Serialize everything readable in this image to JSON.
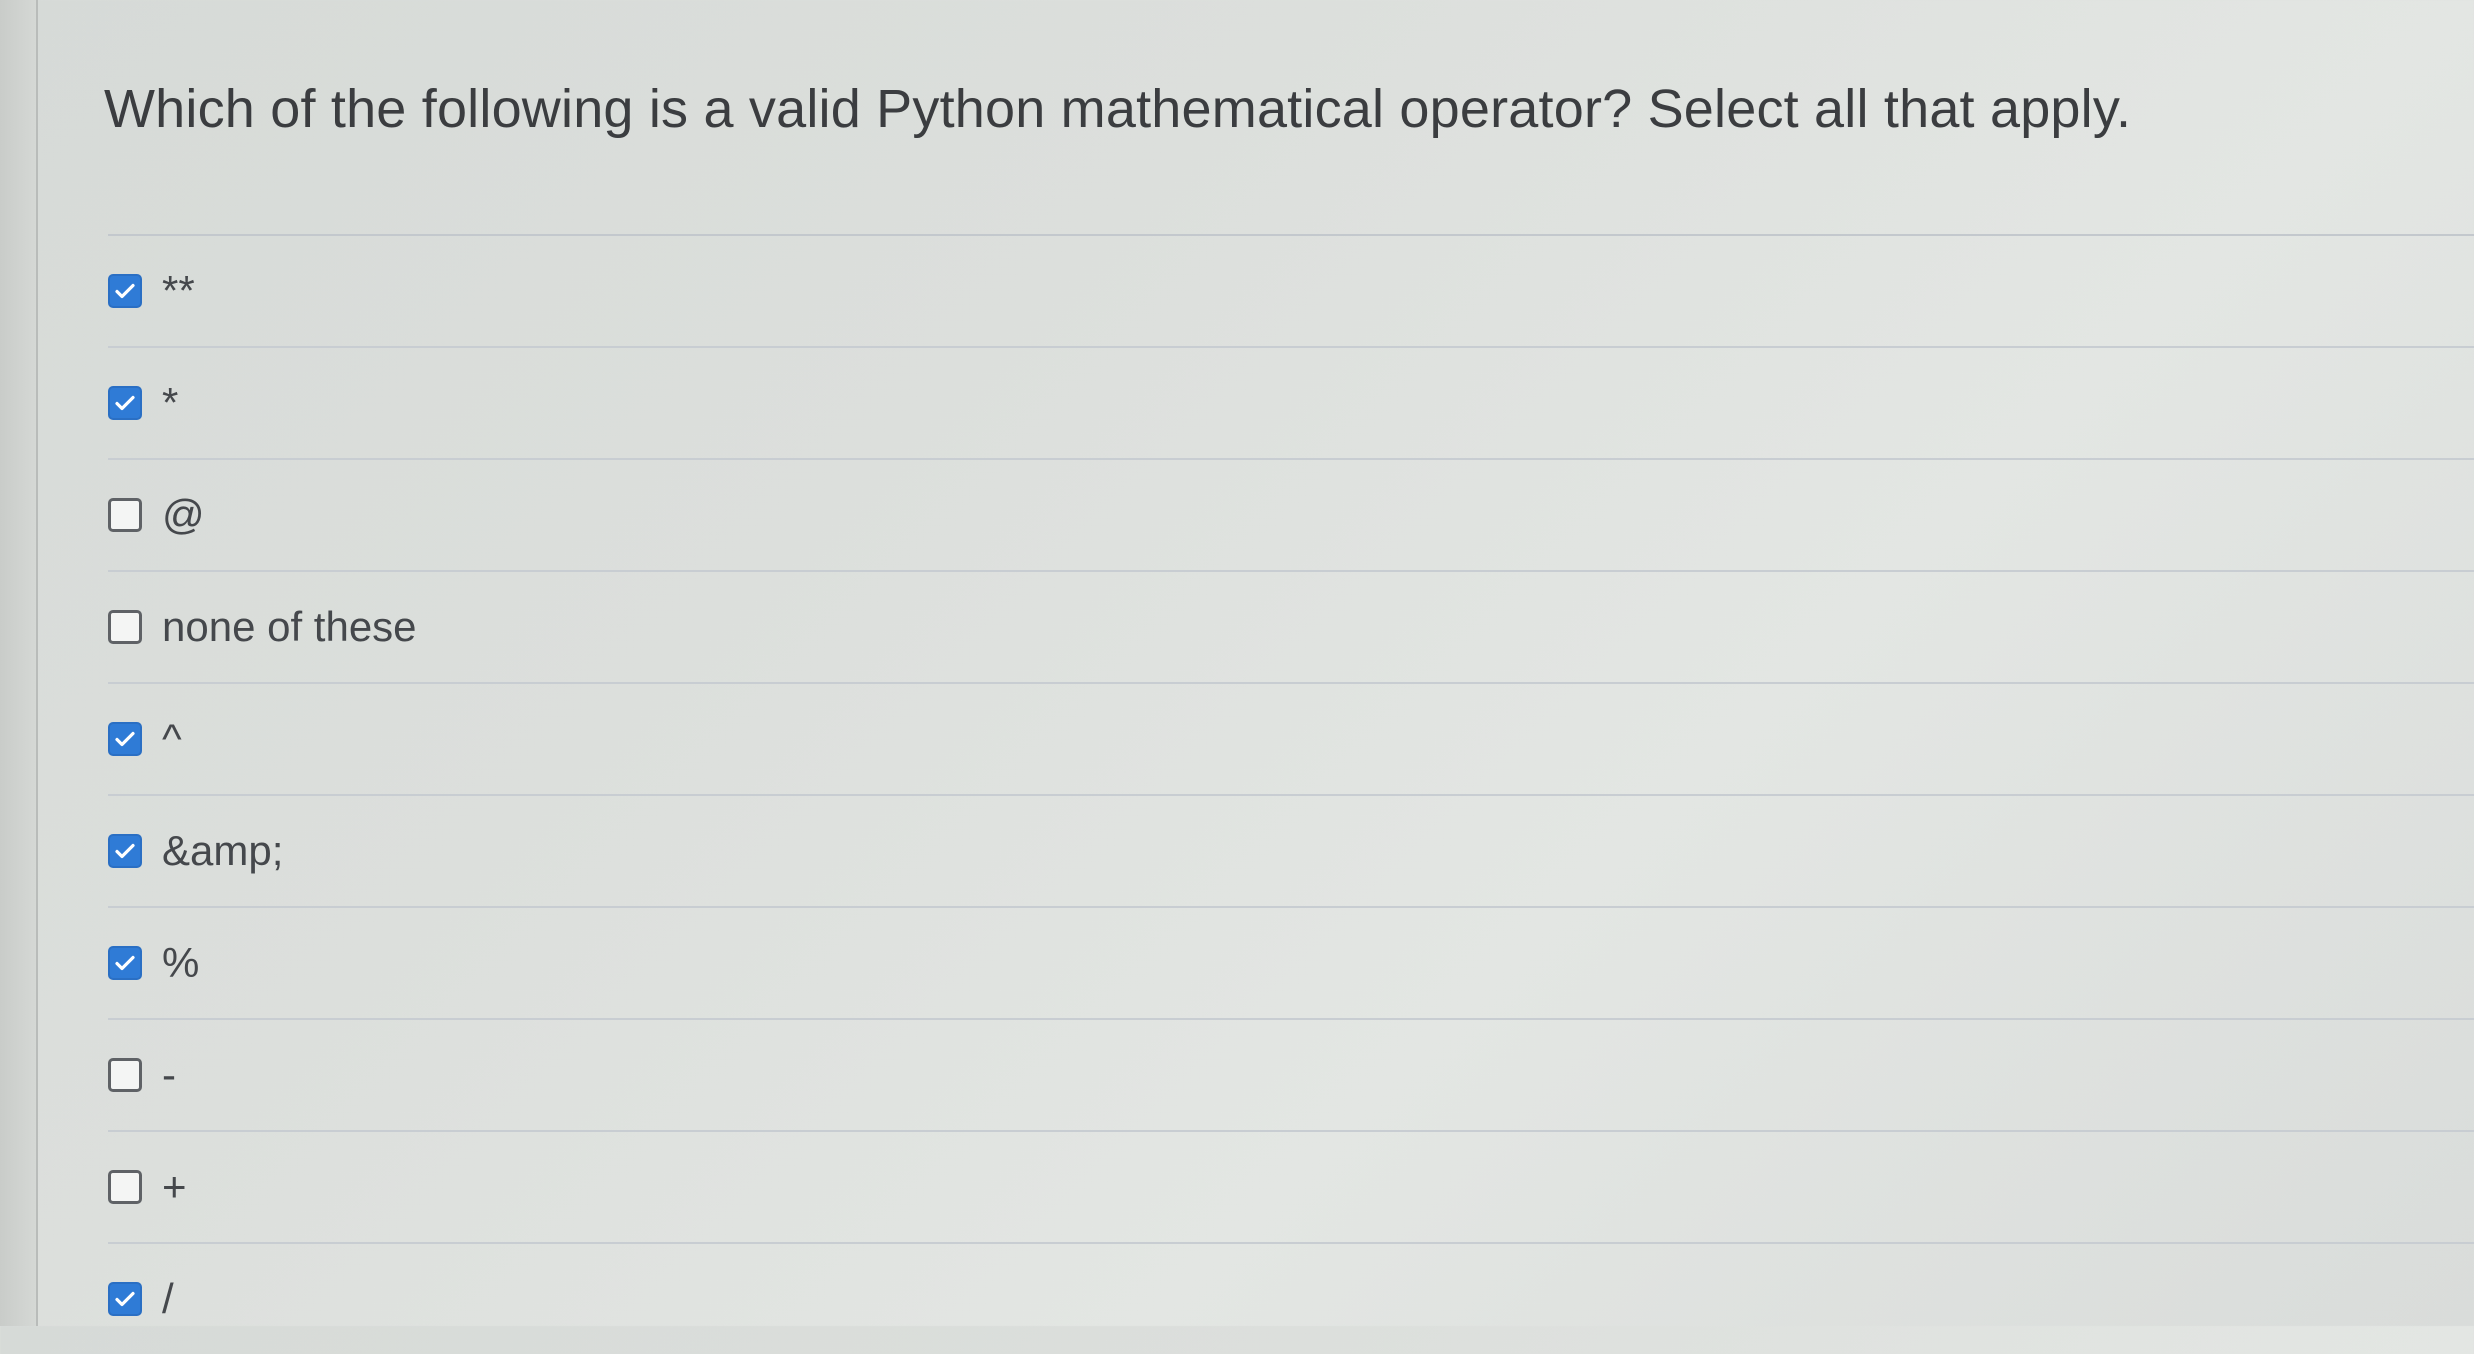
{
  "question": {
    "text": "Which of the following is a valid Python mathematical operator? Select all that apply."
  },
  "options": [
    {
      "label": "**",
      "checked": true
    },
    {
      "label": "*",
      "checked": true
    },
    {
      "label": "@",
      "checked": false
    },
    {
      "label": "none of these",
      "checked": false
    },
    {
      "label": "^",
      "checked": true
    },
    {
      "label": "&amp;",
      "checked": true
    },
    {
      "label": "%",
      "checked": true
    },
    {
      "label": "-",
      "checked": false
    },
    {
      "label": "+",
      "checked": false
    },
    {
      "label": "/",
      "checked": true
    }
  ],
  "colors": {
    "checked": "#2f7bd6",
    "text": "#45484c"
  },
  "icons": {
    "checked": "checkmark-icon"
  }
}
